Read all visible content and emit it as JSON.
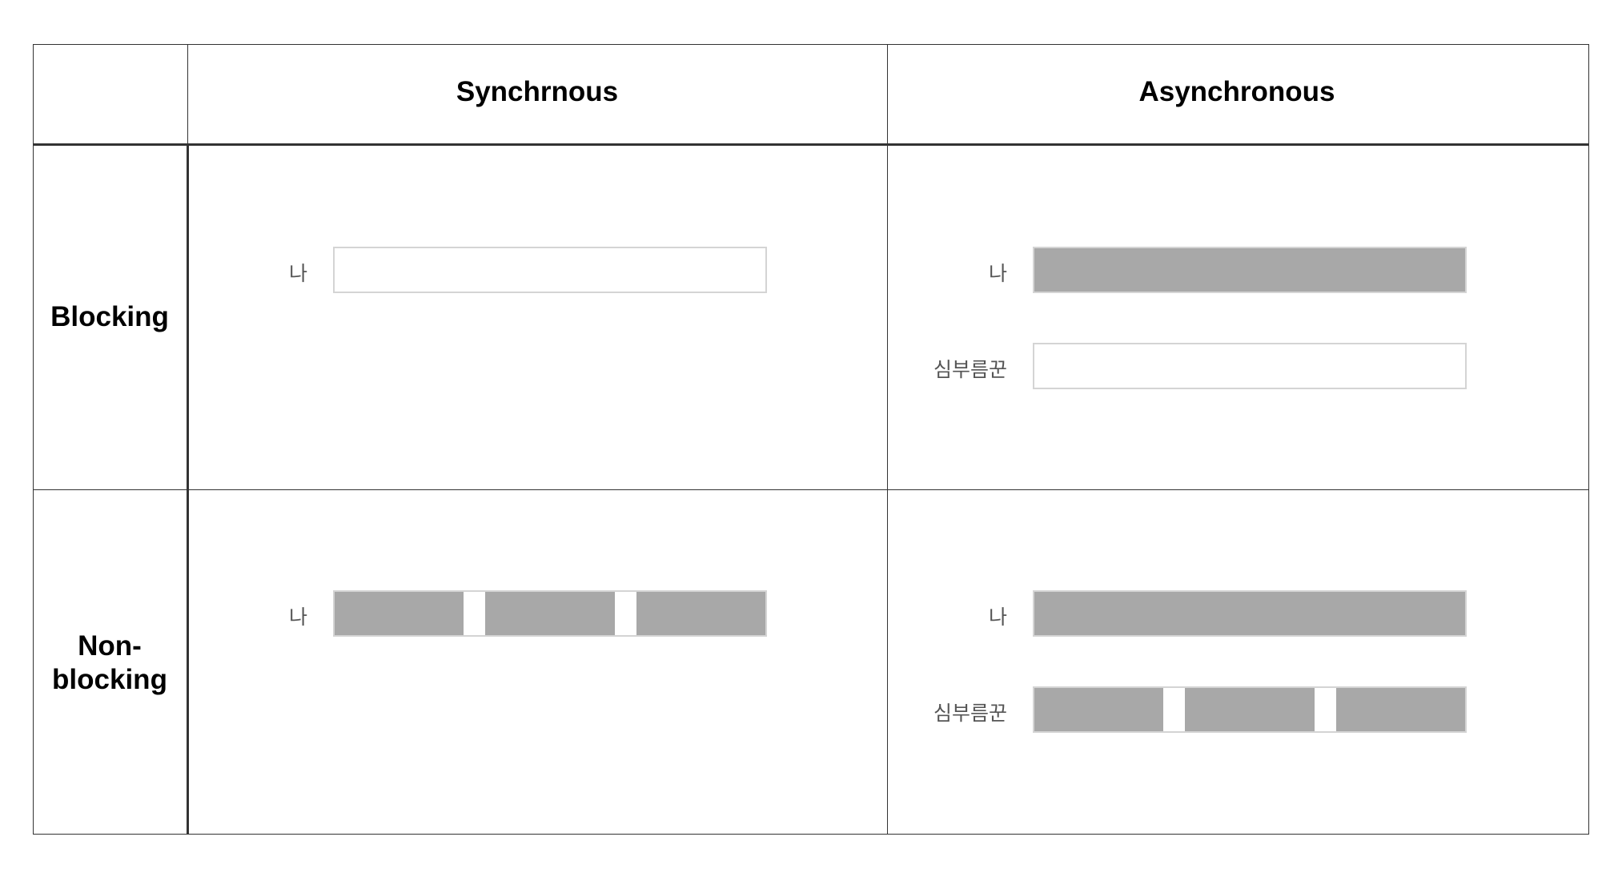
{
  "table": {
    "column_headers": [
      "Synchrnous",
      "Asynchronous"
    ],
    "row_headers": [
      "Blocking",
      "Non-\nblocking"
    ]
  },
  "colors": {
    "active": "#a8a8a8",
    "idle_border": "#d4d4d4",
    "grid_line": "#333333"
  },
  "cells": {
    "blocking_sync": {
      "lanes": [
        {
          "label": "나",
          "active_segments": []
        }
      ]
    },
    "blocking_async": {
      "lanes": [
        {
          "label": "나",
          "active_segments": [
            [
              0,
              1
            ]
          ]
        },
        {
          "label": "심부름꾼",
          "active_segments": []
        }
      ]
    },
    "nonblocking_sync": {
      "lanes": [
        {
          "label": "나",
          "active_segments": [
            [
              0,
              0.3
            ],
            [
              0.35,
              0.65
            ],
            [
              0.7,
              1
            ]
          ]
        }
      ]
    },
    "nonblocking_async": {
      "lanes": [
        {
          "label": "나",
          "active_segments": [
            [
              0,
              1
            ]
          ]
        },
        {
          "label": "심부름꾼",
          "active_segments": [
            [
              0,
              0.3
            ],
            [
              0.35,
              0.65
            ],
            [
              0.7,
              1
            ]
          ]
        }
      ]
    }
  }
}
